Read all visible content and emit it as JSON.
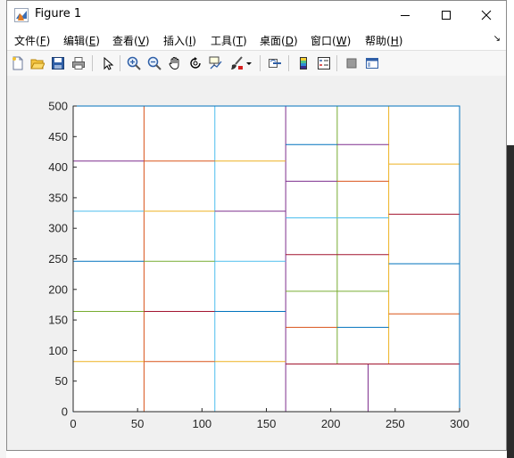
{
  "window": {
    "title": "Figure 1",
    "controls": {
      "minimize": "minimize",
      "maximize": "maximize",
      "close": "close"
    }
  },
  "menu": {
    "items": [
      {
        "label": "文件(",
        "key": "F",
        "suffix": ")"
      },
      {
        "label": "编辑(",
        "key": "E",
        "suffix": ")"
      },
      {
        "label": "查看(",
        "key": "V",
        "suffix": ")"
      },
      {
        "label": "插入(",
        "key": "I",
        "suffix": ")"
      },
      {
        "label": "工具(",
        "key": "T",
        "suffix": ")"
      },
      {
        "label": "桌面(",
        "key": "D",
        "suffix": ")"
      },
      {
        "label": "窗口(",
        "key": "W",
        "suffix": ")"
      },
      {
        "label": "帮助(",
        "key": "H",
        "suffix": ")"
      }
    ],
    "expand_glyph": "↘"
  },
  "toolbar": {
    "icons": [
      "new-figure-icon",
      "open-file-icon",
      "save-icon",
      "print-icon",
      "edit-plot-icon",
      "zoom-in-icon",
      "zoom-out-icon",
      "pan-icon",
      "rotate-3d-icon",
      "data-cursor-icon",
      "brush-icon",
      "brush-dropdown-icon",
      "link-plot-icon",
      "colorbar-icon",
      "legend-icon",
      "hide-plot-tools-icon",
      "show-plot-tools-icon"
    ]
  },
  "colors": {
    "blue": "#0072BD",
    "orange": "#D95319",
    "yellow": "#EDB120",
    "purple": "#7E2F8E",
    "green": "#77AC30",
    "cyan": "#4DBEEE",
    "red": "#A2142F",
    "axes": "#0072BD"
  },
  "chart_data": {
    "type": "line",
    "title": "",
    "xlabel": "",
    "ylabel": "",
    "xlim": [
      0,
      300
    ],
    "ylim": [
      0,
      500
    ],
    "grid": false,
    "xticks": [
      "0",
      "50",
      "100",
      "150",
      "200",
      "250",
      "300"
    ],
    "yticks": [
      "0",
      "50",
      "100",
      "150",
      "200",
      "250",
      "300",
      "350",
      "400",
      "450",
      "500"
    ],
    "segments": [
      {
        "x": [
          55,
          55
        ],
        "y": [
          0,
          500
        ],
        "color": "#D95319"
      },
      {
        "x": [
          110,
          110
        ],
        "y": [
          0,
          500
        ],
        "color": "#4DBEEE"
      },
      {
        "x": [
          165,
          165
        ],
        "y": [
          0,
          500
        ],
        "color": "#7E2F8E"
      },
      {
        "x": [
          205,
          205
        ],
        "y": [
          78,
          500
        ],
        "color": "#77AC30"
      },
      {
        "x": [
          245,
          245
        ],
        "y": [
          78,
          500
        ],
        "color": "#EDB120"
      },
      {
        "x": [
          229,
          229
        ],
        "y": [
          0,
          78
        ],
        "color": "#7E2F8E"
      },
      {
        "x": [
          165,
          300
        ],
        "y": [
          78,
          78
        ],
        "color": "#A2142F"
      },
      {
        "x": [
          0,
          55
        ],
        "y": [
          410,
          410
        ],
        "color": "#7E2F8E"
      },
      {
        "x": [
          0,
          55
        ],
        "y": [
          328,
          328
        ],
        "color": "#4DBEEE"
      },
      {
        "x": [
          0,
          55
        ],
        "y": [
          246,
          246
        ],
        "color": "#0072BD"
      },
      {
        "x": [
          0,
          55
        ],
        "y": [
          164,
          164
        ],
        "color": "#77AC30"
      },
      {
        "x": [
          0,
          55
        ],
        "y": [
          82,
          82
        ],
        "color": "#EDB120"
      },
      {
        "x": [
          55,
          110
        ],
        "y": [
          410,
          410
        ],
        "color": "#D95319"
      },
      {
        "x": [
          55,
          110
        ],
        "y": [
          328,
          328
        ],
        "color": "#EDB120"
      },
      {
        "x": [
          55,
          110
        ],
        "y": [
          246,
          246
        ],
        "color": "#77AC30"
      },
      {
        "x": [
          55,
          110
        ],
        "y": [
          164,
          164
        ],
        "color": "#A2142F"
      },
      {
        "x": [
          55,
          110
        ],
        "y": [
          82,
          82
        ],
        "color": "#D95319"
      },
      {
        "x": [
          110,
          165
        ],
        "y": [
          410,
          410
        ],
        "color": "#EDB120"
      },
      {
        "x": [
          110,
          165
        ],
        "y": [
          328,
          328
        ],
        "color": "#7E2F8E"
      },
      {
        "x": [
          110,
          165
        ],
        "y": [
          246,
          246
        ],
        "color": "#4DBEEE"
      },
      {
        "x": [
          110,
          165
        ],
        "y": [
          164,
          164
        ],
        "color": "#0072BD"
      },
      {
        "x": [
          110,
          165
        ],
        "y": [
          82,
          82
        ],
        "color": "#EDB120"
      },
      {
        "x": [
          165,
          205
        ],
        "y": [
          437,
          437
        ],
        "color": "#0072BD"
      },
      {
        "x": [
          165,
          205
        ],
        "y": [
          377,
          377
        ],
        "color": "#7E2F8E"
      },
      {
        "x": [
          165,
          205
        ],
        "y": [
          317,
          317
        ],
        "color": "#4DBEEE"
      },
      {
        "x": [
          165,
          205
        ],
        "y": [
          257,
          257
        ],
        "color": "#A2142F"
      },
      {
        "x": [
          165,
          205
        ],
        "y": [
          197,
          197
        ],
        "color": "#77AC30"
      },
      {
        "x": [
          165,
          205
        ],
        "y": [
          138,
          138
        ],
        "color": "#D95319"
      },
      {
        "x": [
          205,
          245
        ],
        "y": [
          437,
          437
        ],
        "color": "#7E2F8E"
      },
      {
        "x": [
          205,
          245
        ],
        "y": [
          377,
          377
        ],
        "color": "#D95319"
      },
      {
        "x": [
          205,
          245
        ],
        "y": [
          317,
          317
        ],
        "color": "#4DBEEE"
      },
      {
        "x": [
          205,
          245
        ],
        "y": [
          257,
          257
        ],
        "color": "#A2142F"
      },
      {
        "x": [
          205,
          245
        ],
        "y": [
          197,
          197
        ],
        "color": "#77AC30"
      },
      {
        "x": [
          205,
          245
        ],
        "y": [
          138,
          138
        ],
        "color": "#0072BD"
      },
      {
        "x": [
          245,
          300
        ],
        "y": [
          405,
          405
        ],
        "color": "#EDB120"
      },
      {
        "x": [
          245,
          300
        ],
        "y": [
          323,
          323
        ],
        "color": "#A2142F"
      },
      {
        "x": [
          245,
          300
        ],
        "y": [
          242,
          242
        ],
        "color": "#0072BD"
      },
      {
        "x": [
          245,
          300
        ],
        "y": [
          160,
          160
        ],
        "color": "#D95319"
      }
    ]
  }
}
